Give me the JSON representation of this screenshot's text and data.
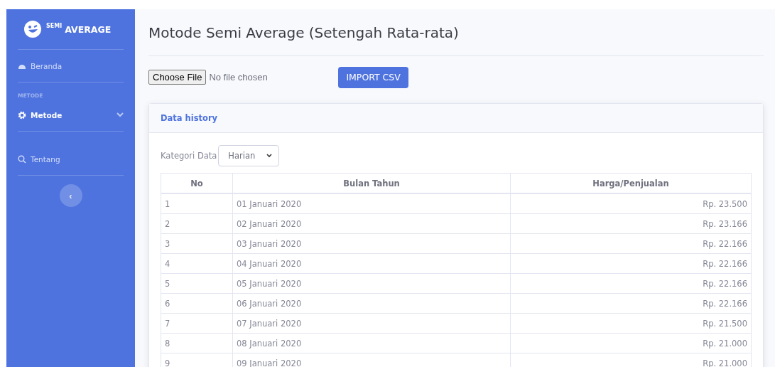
{
  "brand": {
    "small": "SEMI",
    "large": "AVERAGE"
  },
  "sidebar": {
    "items": [
      {
        "kind": "link",
        "label": "Beranda",
        "selected": false
      },
      {
        "kind": "heading",
        "label": "METODE"
      },
      {
        "kind": "link",
        "label": "Metode",
        "selected": true,
        "caret": true
      },
      {
        "kind": "link",
        "label": "Tentang",
        "selected": false
      }
    ],
    "toggle": "‹"
  },
  "page_title": "Motode Semi Average (Setengah Rata-rata)",
  "file_input": {
    "button": "Choose File",
    "status": "No file chosen"
  },
  "import_button": "IMPORT CSV",
  "card": {
    "title": "Data history",
    "filter_label": "Kategori Data",
    "filter_value": "Harian",
    "table": {
      "columns": [
        "No",
        "Bulan Tahun",
        "Harga/Penjualan"
      ],
      "rows": [
        [
          "1",
          "01 Januari 2020",
          "Rp. 23.500"
        ],
        [
          "2",
          "02 Januari 2020",
          "Rp. 23.166"
        ],
        [
          "3",
          "03 Januari 2020",
          "Rp. 22.166"
        ],
        [
          "4",
          "04 Januari 2020",
          "Rp. 22.166"
        ],
        [
          "5",
          "05 Januari 2020",
          "Rp. 22.166"
        ],
        [
          "6",
          "06 Januari 2020",
          "Rp. 22.166"
        ],
        [
          "7",
          "07 Januari 2020",
          "Rp. 21.500"
        ],
        [
          "8",
          "08 Januari 2020",
          "Rp. 21.000"
        ],
        [
          "9",
          "09 Januari 2020",
          "Rp. 21.000"
        ]
      ]
    }
  }
}
